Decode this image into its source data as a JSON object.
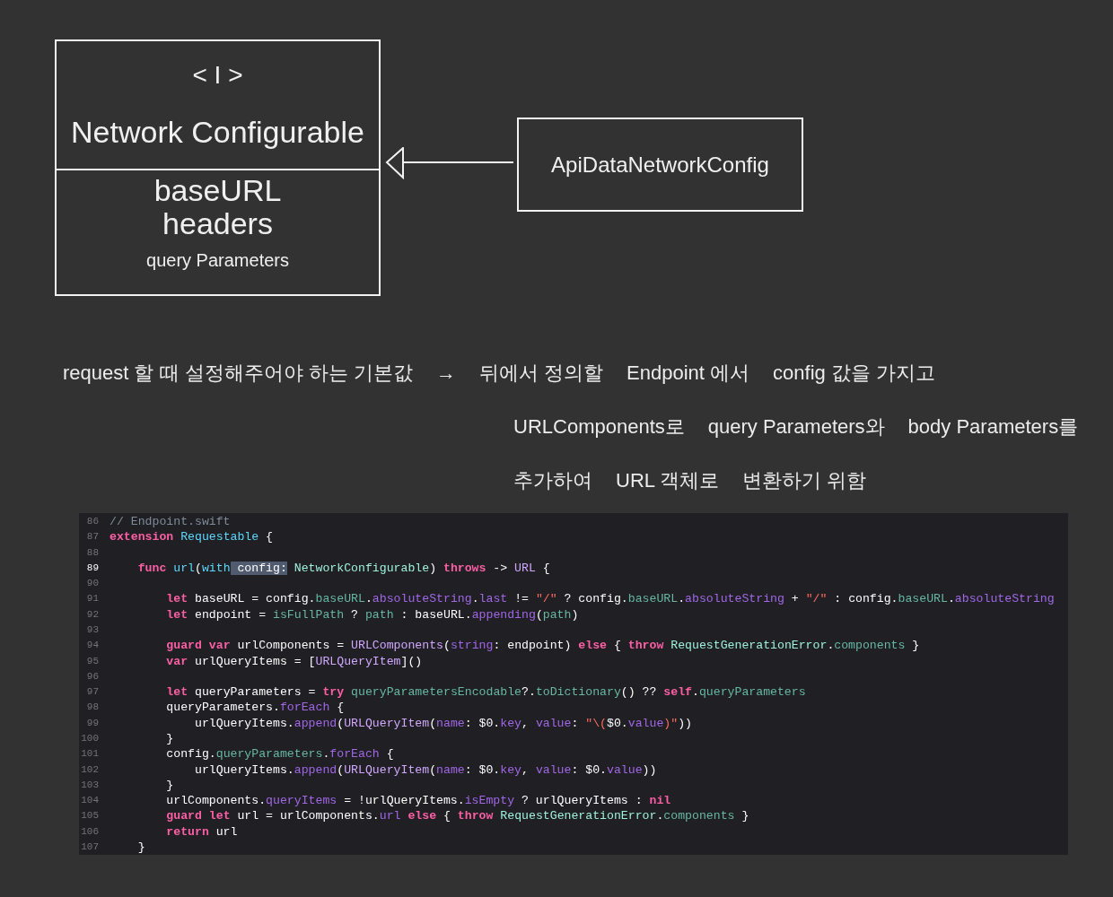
{
  "diagram": {
    "interface_box": {
      "stereotype": "< I >",
      "title": "Network Configurable",
      "members": [
        "baseURL",
        "headers",
        "query Parameters"
      ]
    },
    "class_box": {
      "title": "ApiDataNetworkConfig"
    }
  },
  "notes": [
    [
      "request 할 때 설정해주어야 하는 기본값",
      "→",
      "뒤에서 정의할",
      "Endpoint 에서",
      "config 값을 가지고"
    ],
    [
      "URLComponents로",
      "query Parameters와",
      "body Parameters를"
    ],
    [
      "추가하여",
      "URL 객체로",
      "변환하기 위함"
    ]
  ],
  "code": {
    "lines": [
      {
        "number": "86",
        "current": false,
        "tokens": [
          {
            "text": "// Endpoint.swift",
            "kind": "comment"
          }
        ]
      },
      {
        "number": "87",
        "current": false,
        "tokens": [
          {
            "text": "extension",
            "kind": "keyword"
          },
          {
            "text": " Requestable",
            "kind": "decl"
          },
          {
            "text": " {",
            "kind": "plain"
          }
        ]
      },
      {
        "number": "88",
        "current": false
      },
      {
        "number": "89",
        "current": true,
        "tokens": [
          {
            "text": "    func",
            "kind": "keyword"
          },
          {
            "text": " url",
            "kind": "decl"
          },
          {
            "text": "(",
            "kind": "plain"
          },
          {
            "text": "with",
            "kind": "decl"
          },
          {
            "text": " config:",
            "kind": "selection"
          },
          {
            "text": " NetworkConfigurable",
            "kind": "projtype"
          },
          {
            "text": ") ",
            "kind": "plain"
          },
          {
            "text": "throws",
            "kind": "keyword"
          },
          {
            "text": " -> ",
            "kind": "plain"
          },
          {
            "text": "URL",
            "kind": "systype"
          },
          {
            "text": " {",
            "kind": "plain"
          }
        ]
      },
      {
        "number": "90",
        "current": false
      },
      {
        "number": "91",
        "current": false,
        "tokens": [
          {
            "text": "        let",
            "kind": "keyword"
          },
          {
            "text": " baseURL = config.",
            "kind": "plain"
          },
          {
            "text": "baseURL",
            "kind": "projmember"
          },
          {
            "text": ".",
            "kind": "plain"
          },
          {
            "text": "absoluteString",
            "kind": "sysmember"
          },
          {
            "text": ".",
            "kind": "plain"
          },
          {
            "text": "last",
            "kind": "sysmember"
          },
          {
            "text": " != ",
            "kind": "plain"
          },
          {
            "text": "\"/\"",
            "kind": "string"
          },
          {
            "text": " ? config.",
            "kind": "plain"
          },
          {
            "text": "baseURL",
            "kind": "projmember"
          },
          {
            "text": ".",
            "kind": "plain"
          },
          {
            "text": "absoluteString",
            "kind": "sysmember"
          },
          {
            "text": " + ",
            "kind": "plain"
          },
          {
            "text": "\"/\"",
            "kind": "string"
          },
          {
            "text": " : config.",
            "kind": "plain"
          },
          {
            "text": "baseURL",
            "kind": "projmember"
          },
          {
            "text": ".",
            "kind": "plain"
          },
          {
            "text": "absoluteString",
            "kind": "sysmember"
          }
        ]
      },
      {
        "number": "92",
        "current": false,
        "tokens": [
          {
            "text": "        let",
            "kind": "keyword"
          },
          {
            "text": " endpoint = ",
            "kind": "plain"
          },
          {
            "text": "isFullPath",
            "kind": "projmember"
          },
          {
            "text": " ? ",
            "kind": "plain"
          },
          {
            "text": "path",
            "kind": "projmember"
          },
          {
            "text": " : baseURL.",
            "kind": "plain"
          },
          {
            "text": "appending",
            "kind": "sysmember"
          },
          {
            "text": "(",
            "kind": "plain"
          },
          {
            "text": "path",
            "kind": "projmember"
          },
          {
            "text": ")",
            "kind": "plain"
          }
        ]
      },
      {
        "number": "93",
        "current": false
      },
      {
        "number": "94",
        "current": false,
        "tokens": [
          {
            "text": "        guard",
            "kind": "keyword"
          },
          {
            "text": " var",
            "kind": "keyword"
          },
          {
            "text": " urlComponents = ",
            "kind": "plain"
          },
          {
            "text": "URLComponents",
            "kind": "systype"
          },
          {
            "text": "(",
            "kind": "plain"
          },
          {
            "text": "string",
            "kind": "sysmember"
          },
          {
            "text": ": endpoint) ",
            "kind": "plain"
          },
          {
            "text": "else",
            "kind": "keyword"
          },
          {
            "text": " { ",
            "kind": "plain"
          },
          {
            "text": "throw",
            "kind": "keyword"
          },
          {
            "text": " RequestGenerationError",
            "kind": "projtype"
          },
          {
            "text": ".",
            "kind": "plain"
          },
          {
            "text": "components",
            "kind": "projmember"
          },
          {
            "text": " }",
            "kind": "plain"
          }
        ]
      },
      {
        "number": "95",
        "current": false,
        "tokens": [
          {
            "text": "        var",
            "kind": "keyword"
          },
          {
            "text": " urlQueryItems = [",
            "kind": "plain"
          },
          {
            "text": "URLQueryItem",
            "kind": "systype"
          },
          {
            "text": "]()",
            "kind": "plain"
          }
        ]
      },
      {
        "number": "96",
        "current": false
      },
      {
        "number": "97",
        "current": false,
        "tokens": [
          {
            "text": "        let",
            "kind": "keyword"
          },
          {
            "text": " queryParameters = ",
            "kind": "plain"
          },
          {
            "text": "try",
            "kind": "keyword"
          },
          {
            "text": " queryParametersEncodable",
            "kind": "projmember"
          },
          {
            "text": "?.",
            "kind": "plain"
          },
          {
            "text": "toDictionary",
            "kind": "projmember"
          },
          {
            "text": "() ?? ",
            "kind": "plain"
          },
          {
            "text": "self",
            "kind": "keyword"
          },
          {
            "text": ".",
            "kind": "plain"
          },
          {
            "text": "queryParameters",
            "kind": "projmember"
          }
        ]
      },
      {
        "number": "98",
        "current": false,
        "tokens": [
          {
            "text": "        queryParameters.",
            "kind": "plain"
          },
          {
            "text": "forEach",
            "kind": "sysmember"
          },
          {
            "text": " {",
            "kind": "plain"
          }
        ]
      },
      {
        "number": "99",
        "current": false,
        "tokens": [
          {
            "text": "            urlQueryItems.",
            "kind": "plain"
          },
          {
            "text": "append",
            "kind": "sysmember"
          },
          {
            "text": "(",
            "kind": "plain"
          },
          {
            "text": "URLQueryItem",
            "kind": "systype"
          },
          {
            "text": "(",
            "kind": "plain"
          },
          {
            "text": "name",
            "kind": "sysmember"
          },
          {
            "text": ": $0.",
            "kind": "plain"
          },
          {
            "text": "key",
            "kind": "sysmember"
          },
          {
            "text": ", ",
            "kind": "plain"
          },
          {
            "text": "value",
            "kind": "sysmember"
          },
          {
            "text": ": ",
            "kind": "plain"
          },
          {
            "text": "\"\\(",
            "kind": "string"
          },
          {
            "text": "$0.",
            "kind": "plain"
          },
          {
            "text": "value",
            "kind": "sysmember"
          },
          {
            "text": ")\"",
            "kind": "string"
          },
          {
            "text": "))",
            "kind": "plain"
          }
        ]
      },
      {
        "number": "100",
        "current": false,
        "tokens": [
          {
            "text": "        }",
            "kind": "plain"
          }
        ]
      },
      {
        "number": "101",
        "current": false,
        "tokens": [
          {
            "text": "        config.",
            "kind": "plain"
          },
          {
            "text": "queryParameters",
            "kind": "projmember"
          },
          {
            "text": ".",
            "kind": "plain"
          },
          {
            "text": "forEach",
            "kind": "sysmember"
          },
          {
            "text": " {",
            "kind": "plain"
          }
        ]
      },
      {
        "number": "102",
        "current": false,
        "tokens": [
          {
            "text": "            urlQueryItems.",
            "kind": "plain"
          },
          {
            "text": "append",
            "kind": "sysmember"
          },
          {
            "text": "(",
            "kind": "plain"
          },
          {
            "text": "URLQueryItem",
            "kind": "systype"
          },
          {
            "text": "(",
            "kind": "plain"
          },
          {
            "text": "name",
            "kind": "sysmember"
          },
          {
            "text": ": $0.",
            "kind": "plain"
          },
          {
            "text": "key",
            "kind": "sysmember"
          },
          {
            "text": ", ",
            "kind": "plain"
          },
          {
            "text": "value",
            "kind": "sysmember"
          },
          {
            "text": ": $0.",
            "kind": "plain"
          },
          {
            "text": "value",
            "kind": "sysmember"
          },
          {
            "text": "))",
            "kind": "plain"
          }
        ]
      },
      {
        "number": "103",
        "current": false,
        "tokens": [
          {
            "text": "        }",
            "kind": "plain"
          }
        ]
      },
      {
        "number": "104",
        "current": false,
        "tokens": [
          {
            "text": "        urlComponents.",
            "kind": "plain"
          },
          {
            "text": "queryItems",
            "kind": "sysmember"
          },
          {
            "text": " = !urlQueryItems.",
            "kind": "plain"
          },
          {
            "text": "isEmpty",
            "kind": "sysmember"
          },
          {
            "text": " ? urlQueryItems : ",
            "kind": "plain"
          },
          {
            "text": "nil",
            "kind": "keyword"
          }
        ]
      },
      {
        "number": "105",
        "current": false,
        "tokens": [
          {
            "text": "        guard",
            "kind": "keyword"
          },
          {
            "text": " let",
            "kind": "keyword"
          },
          {
            "text": " url = urlComponents.",
            "kind": "plain"
          },
          {
            "text": "url",
            "kind": "sysmember"
          },
          {
            "text": " else",
            "kind": "keyword"
          },
          {
            "text": " { ",
            "kind": "plain"
          },
          {
            "text": "throw",
            "kind": "keyword"
          },
          {
            "text": " RequestGenerationError",
            "kind": "projtype"
          },
          {
            "text": ".",
            "kind": "plain"
          },
          {
            "text": "components",
            "kind": "projmember"
          },
          {
            "text": " }",
            "kind": "plain"
          }
        ]
      },
      {
        "number": "106",
        "current": false,
        "tokens": [
          {
            "text": "        return",
            "kind": "keyword"
          },
          {
            "text": " url",
            "kind": "plain"
          }
        ]
      },
      {
        "number": "107",
        "current": false,
        "tokens": [
          {
            "text": "    }",
            "kind": "plain"
          }
        ]
      }
    ]
  }
}
